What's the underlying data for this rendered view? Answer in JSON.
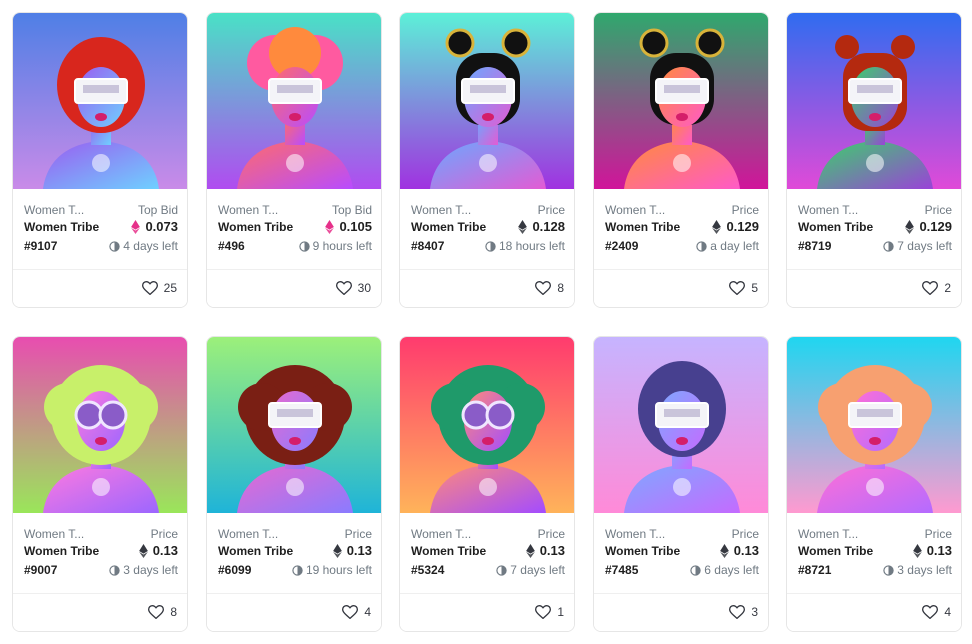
{
  "cards": [
    {
      "collection": "Women T...",
      "label": "Top Bid",
      "name": "Women Tribe",
      "price": "0.073",
      "currency_icon": "weth-icon",
      "token": "#9107",
      "time": "4 days left",
      "likes": "25",
      "bg": [
        "#4f7fe6",
        "#c98be8"
      ],
      "hair": "#d8261d",
      "body": [
        "#9a5cf0",
        "#6fd0ff"
      ]
    },
    {
      "collection": "Women T...",
      "label": "Top Bid",
      "name": "Women Tribe",
      "price": "0.105",
      "currency_icon": "weth-icon",
      "token": "#496",
      "time": "9 hours left",
      "likes": "30",
      "bg": [
        "#49e1c6",
        "#b04cf0"
      ],
      "hair": "#ff5aa0",
      "body": [
        "#ff6b6b",
        "#b84cff"
      ]
    },
    {
      "collection": "Women T...",
      "label": "Price",
      "name": "Women Tribe",
      "price": "0.128",
      "currency_icon": "eth-icon",
      "token": "#8407",
      "time": "18 hours left",
      "likes": "8",
      "bg": [
        "#5cf0d8",
        "#a032e0"
      ],
      "hair": "#111111",
      "body": [
        "#6aa8ff",
        "#e35bd4"
      ]
    },
    {
      "collection": "Women T...",
      "label": "Price",
      "name": "Women Tribe",
      "price": "0.129",
      "currency_icon": "eth-icon",
      "token": "#2409",
      "time": "a day left",
      "likes": "5",
      "bg": [
        "#2fa86d",
        "#d1149a"
      ],
      "hair": "#111111",
      "body": [
        "#ff8a3d",
        "#ff5ac8"
      ]
    },
    {
      "collection": "Women T...",
      "label": "Price",
      "name": "Women Tribe",
      "price": "0.129",
      "currency_icon": "eth-icon",
      "token": "#8719",
      "time": "7 days left",
      "likes": "2",
      "bg": [
        "#2f6cf0",
        "#e04ad8"
      ],
      "hair": "#b4290f",
      "body": [
        "#3bd16a",
        "#9a42d8"
      ]
    },
    {
      "collection": "Women T...",
      "label": "Price",
      "name": "Women Tribe",
      "price": "0.13",
      "currency_icon": "eth-icon",
      "token": "#9007",
      "time": "3 days left",
      "likes": "8",
      "bg": [
        "#e84db0",
        "#9ae65a"
      ],
      "hair": "#c8f06a",
      "body": [
        "#ff7adf",
        "#9c66ff"
      ]
    },
    {
      "collection": "Women T...",
      "label": "Price",
      "name": "Women Tribe",
      "price": "0.13",
      "currency_icon": "eth-icon",
      "token": "#6099",
      "time": "19 hours left",
      "likes": "4",
      "bg": [
        "#9cf07a",
        "#1fb4d8"
      ],
      "hair": "#7a1f14",
      "body": [
        "#e76ad0",
        "#8a7bff"
      ]
    },
    {
      "collection": "Women T...",
      "label": "Price",
      "name": "Women Tribe",
      "price": "0.13",
      "currency_icon": "eth-icon",
      "token": "#5324",
      "time": "7 days left",
      "likes": "1",
      "bg": [
        "#ff3b6e",
        "#ffb35a"
      ],
      "hair": "#1f9a6a",
      "body": [
        "#ff8a7a",
        "#a34cff"
      ]
    },
    {
      "collection": "Women T...",
      "label": "Price",
      "name": "Women Tribe",
      "price": "0.13",
      "currency_icon": "eth-icon",
      "token": "#7485",
      "time": "6 days left",
      "likes": "3",
      "bg": [
        "#c6b4ff",
        "#ff8ad8"
      ],
      "hair": "#47408f",
      "body": [
        "#7fa8ff",
        "#c46bff"
      ]
    },
    {
      "collection": "Women T...",
      "label": "Price",
      "name": "Women Tribe",
      "price": "0.13",
      "currency_icon": "eth-icon",
      "token": "#8721",
      "time": "3 days left",
      "likes": "4",
      "bg": [
        "#1fd6f0",
        "#ff9ad0"
      ],
      "hair": "#f7a070",
      "body": [
        "#ff6fd6",
        "#b46bff"
      ]
    }
  ],
  "colors": {
    "weth": "#e6308a",
    "eth": "#353840",
    "muted": "#707a83"
  }
}
